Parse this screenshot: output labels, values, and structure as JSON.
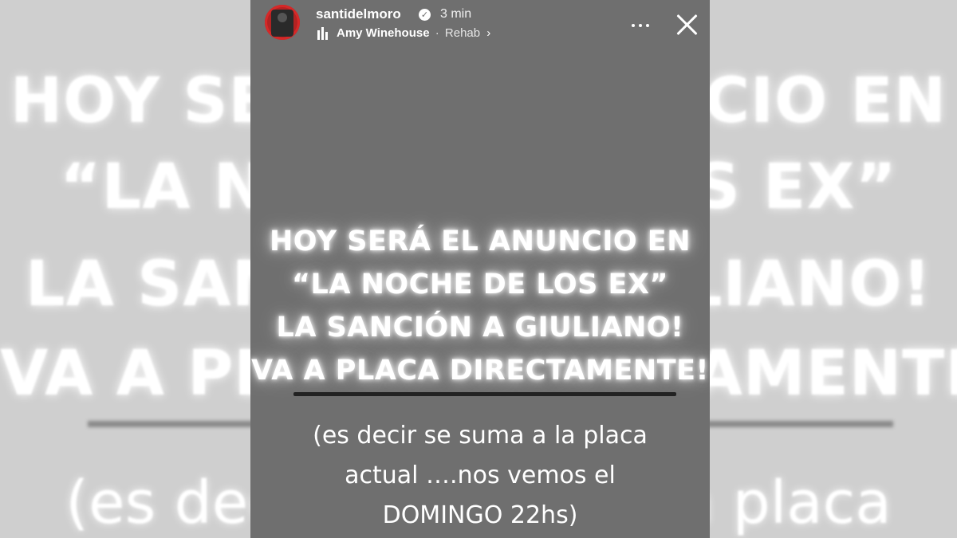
{
  "header": {
    "username": "santidelmoro",
    "verified_mark": "✓",
    "time": "3 min",
    "music": {
      "artist": "Amy Winehouse",
      "separator": "·",
      "track": "Rehab",
      "chevron": "›"
    },
    "more_icon": "more-horizontal-icon",
    "close_icon": "close-icon"
  },
  "story": {
    "headline_lines": [
      "HOY SERÁ EL ANUNCIO EN",
      "“LA NOCHE DE LOS EX”",
      "LA SANCIÓN A GIULIANO!",
      "VA A PLACA DIRECTAMENTE!"
    ],
    "sub_lines": [
      "(es decir se suma a la placa",
      "actual ….nos vemos el",
      "DOMINGO 22hs)"
    ]
  },
  "background": {
    "lines": [
      "HOY SERÁ EL ANUNCIO EN",
      "“LA NOCHE DE LOS EX”",
      "LA SANCIÓN A GIULIANO!",
      "VA A PLACA DIRECTAMENTE!"
    ],
    "sub": "(es decir se suma a la placa"
  },
  "colors": {
    "story_bg": "#6f6f6f",
    "page_bg": "#cfcfcf",
    "text": "#ffffff",
    "avatar_ring": "#d62828"
  }
}
